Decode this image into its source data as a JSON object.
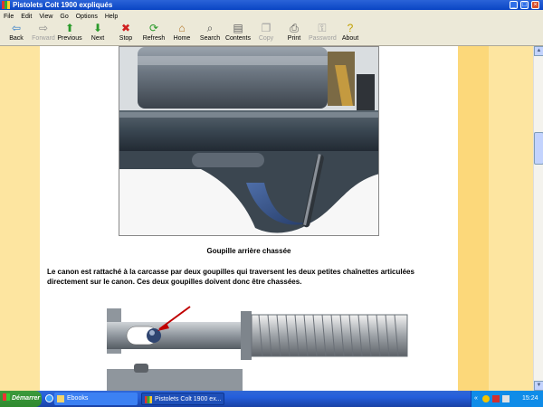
{
  "window": {
    "title": "Pistolets Colt 1900 expliqués",
    "controls": {
      "minimize": "_",
      "maximize": "□",
      "close": "×"
    }
  },
  "menu": [
    "File",
    "Edit",
    "View",
    "Go",
    "Options",
    "Help"
  ],
  "toolbar": [
    {
      "label": "Back",
      "icon": "back-arrow-icon",
      "glyph": "⇦",
      "color": "#2a78c8",
      "enabled": true
    },
    {
      "label": "Forward",
      "icon": "forward-arrow-icon",
      "glyph": "⇨",
      "color": "#8a8a8a",
      "enabled": false
    },
    {
      "label": "Previous",
      "icon": "up-arrow-icon",
      "glyph": "⬆",
      "color": "#2a9a2a",
      "enabled": true
    },
    {
      "label": "Next",
      "icon": "down-arrow-icon",
      "glyph": "⬇",
      "color": "#2a9a2a",
      "enabled": true
    },
    {
      "label": "Stop",
      "icon": "stop-icon",
      "glyph": "✖",
      "color": "#d02020",
      "enabled": true
    },
    {
      "label": "Refresh",
      "icon": "refresh-icon",
      "glyph": "⟳",
      "color": "#2a9a2a",
      "enabled": true
    },
    {
      "label": "Home",
      "icon": "home-icon",
      "glyph": "⌂",
      "color": "#b07020",
      "enabled": true
    },
    {
      "label": "Search",
      "icon": "search-icon",
      "glyph": "⌕",
      "color": "#505050",
      "enabled": true
    },
    {
      "label": "Contents",
      "icon": "contents-icon",
      "glyph": "▤",
      "color": "#606060",
      "enabled": true
    },
    {
      "label": "Copy",
      "icon": "copy-icon",
      "glyph": "❐",
      "color": "#a0a0a0",
      "enabled": false
    },
    {
      "label": "Print",
      "icon": "print-icon",
      "glyph": "⎙",
      "color": "#505050",
      "enabled": true
    },
    {
      "label": "Password",
      "icon": "key-icon",
      "glyph": "⚿",
      "color": "#a0a0a0",
      "enabled": false
    },
    {
      "label": "About",
      "icon": "help-icon",
      "glyph": "?",
      "color": "#c0a000",
      "enabled": true
    }
  ],
  "content": {
    "photo_caption": "Goupille arrière chassée",
    "paragraph": "Le canon est rattaché à la carcasse par deux goupilles qui traversent les deux petites chaînettes articulées directement sur le canon. Ces deux goupilles doivent donc être chassées.",
    "colors": {
      "page_margin": "#fde5a0",
      "page_margin_dark": "#fcd87a",
      "arrow": "#c00000"
    }
  },
  "taskbar": {
    "start_label": "Démarrer",
    "tasks": [
      {
        "label": "Ebooks",
        "icon": "folder-icon",
        "active": false
      },
      {
        "label": "Pistolets Colt 1900 ex...",
        "icon": "ebook-app-icon",
        "active": true
      }
    ],
    "clock": "15:24"
  }
}
